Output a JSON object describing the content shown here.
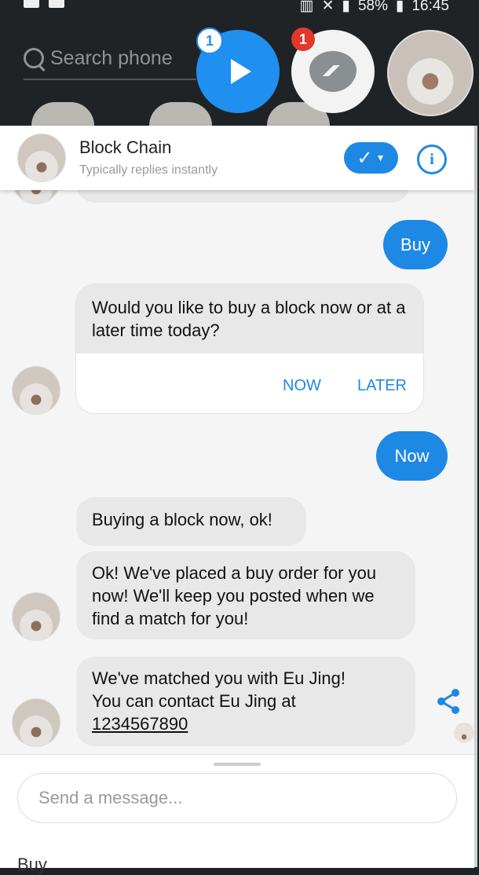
{
  "status_bar": {
    "battery": "58%",
    "time": "16:45"
  },
  "home": {
    "search_placeholder": "Search phone"
  },
  "chat_heads": {
    "play_badge": "1",
    "messenger_badge": "1"
  },
  "header": {
    "name": "Block Chain",
    "subtitle": "Typically replies instantly"
  },
  "messages": {
    "buy": "Buy",
    "question": "Would you like to buy a block now or at a later time today?",
    "option_now": "NOW",
    "option_later": "LATER",
    "now": "Now",
    "buying": "Buying a block now, ok!",
    "placed": "Ok! We've placed a buy order for you now! We'll keep you posted when we find a match for you!",
    "matched_line1": "We've matched you with Eu Jing!",
    "matched_line2": "You can contact Eu Jing at",
    "phone": "1234567890"
  },
  "composer": {
    "placeholder": "Send a message...",
    "quick_reply": "Buy"
  },
  "colors": {
    "accent": "#1e88e5",
    "bubble_bot": "#e8e8e8",
    "badge_red": "#e0382d"
  }
}
